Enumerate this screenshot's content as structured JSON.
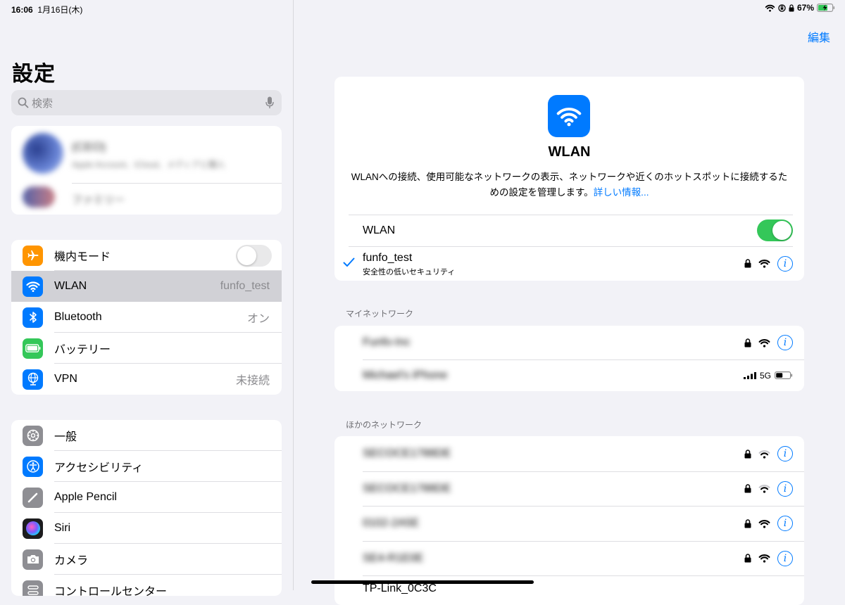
{
  "status": {
    "time": "16:06",
    "date": "1月16日(木)",
    "battery": "67%"
  },
  "sidebar": {
    "title": "設定",
    "search_placeholder": "検索",
    "account": {
      "name": "(CEO)",
      "subtitle": "Apple Account、iCloud、メディアと購入",
      "family": "ファミリー"
    },
    "connectivity": [
      {
        "label": "機内モード",
        "value": "",
        "color": "#ff9500",
        "icon": "airplane-icon",
        "toggle": "off"
      },
      {
        "label": "WLAN",
        "value": "funfo_test",
        "color": "#007aff",
        "icon": "wifi-icon",
        "selected": true
      },
      {
        "label": "Bluetooth",
        "value": "オン",
        "color": "#007aff",
        "icon": "bluetooth-icon"
      },
      {
        "label": "バッテリー",
        "value": "",
        "color": "#34c759",
        "icon": "battery-icon"
      },
      {
        "label": "VPN",
        "value": "未接続",
        "color": "#007aff",
        "icon": "globe-icon"
      }
    ],
    "general": [
      {
        "label": "一般",
        "color": "#8e8e93",
        "icon": "gear-icon"
      },
      {
        "label": "アクセシビリティ",
        "color": "#007aff",
        "icon": "accessibility-icon"
      },
      {
        "label": "Apple Pencil",
        "color": "#8e8e93",
        "icon": "pencil-icon"
      },
      {
        "label": "Siri",
        "color": "#222222",
        "icon": "siri-icon"
      },
      {
        "label": "カメラ",
        "color": "#8e8e93",
        "icon": "camera-icon"
      },
      {
        "label": "コントロールセンター",
        "color": "#8e8e93",
        "icon": "control-center-icon"
      }
    ]
  },
  "detail": {
    "edit_label": "編集",
    "hero_title": "WLAN",
    "hero_desc": "WLANへの接続、使用可能なネットワークの表示、ネットワークや近くのホットスポットに接続するための設定を管理します。",
    "hero_link": "詳しい情報...",
    "wlan_label": "WLAN",
    "wlan_toggle": "on",
    "connected": {
      "name": "funfo_test",
      "subtitle": "安全性の低いセキュリティ"
    },
    "my_networks_header": "マイネットワーク",
    "my_networks": [
      {
        "name": "Funfo-Inc",
        "type": "wifi"
      },
      {
        "name": "Michael's iPhone",
        "type": "hotspot",
        "cell": "5G"
      }
    ],
    "other_networks_header": "ほかのネットワーク",
    "other_networks": [
      {
        "name": "SECOCE1788DE"
      },
      {
        "name": "SECOCE1788DE"
      },
      {
        "name": "0102-2A5E"
      },
      {
        "name": "SE4-R1E0E"
      },
      {
        "name": "TP-Link_0C3C"
      }
    ],
    "accent_color": "#007aff"
  }
}
